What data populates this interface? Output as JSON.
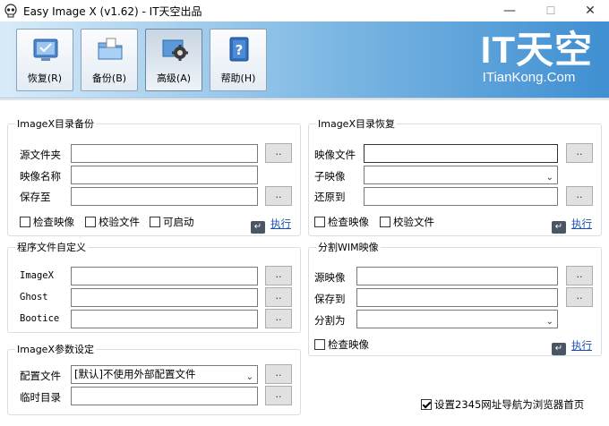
{
  "window": {
    "title": "Easy Image X (v1.62) - IT天空出品",
    "minimize": "—",
    "maximize": "☐",
    "close": "✕"
  },
  "toolbar": {
    "items": [
      {
        "label": "恢复(R)",
        "icon": "restore-icon"
      },
      {
        "label": "备份(B)",
        "icon": "backup-folder-icon"
      },
      {
        "label": "高级(A)",
        "icon": "advanced-gear-icon",
        "active": true
      },
      {
        "label": "帮助(H)",
        "icon": "help-book-icon"
      }
    ]
  },
  "logo": {
    "big": "IT天空",
    "small": "ITianKong.Com"
  },
  "backup": {
    "legend": "ImageX目录备份",
    "source_label": "源文件夹",
    "name_label": "映像名称",
    "save_label": "保存至",
    "browse": "..",
    "check_verify": "检查映像",
    "check_checksum": "校验文件",
    "check_bootable": "可启动",
    "execute": "执行"
  },
  "restore": {
    "legend": "ImageX目录恢复",
    "image_label": "映像文件",
    "subimage_label": "子映像",
    "restore_to_label": "还原到",
    "browse": "..",
    "check_verify": "检查映像",
    "check_checksum": "校验文件",
    "execute": "执行"
  },
  "programs": {
    "legend": "程序文件自定义",
    "imagex_label": "ImageX",
    "ghost_label": "Ghost",
    "bootice_label": "Bootice",
    "browse": ".."
  },
  "split": {
    "legend": "分割WIM映像",
    "source_label": "源映像",
    "save_label": "保存到",
    "split_label": "分割为",
    "browse": "..",
    "check_verify": "检查映像",
    "execute": "执行"
  },
  "params": {
    "legend": "ImageX参数设定",
    "config_label": "配置文件",
    "config_value": "[默认]不使用外部配置文件",
    "temp_label": "临时目录",
    "browse": ".."
  },
  "footer": {
    "homepage_check": "设置2345网址导航为浏览器首页",
    "checked": true
  }
}
